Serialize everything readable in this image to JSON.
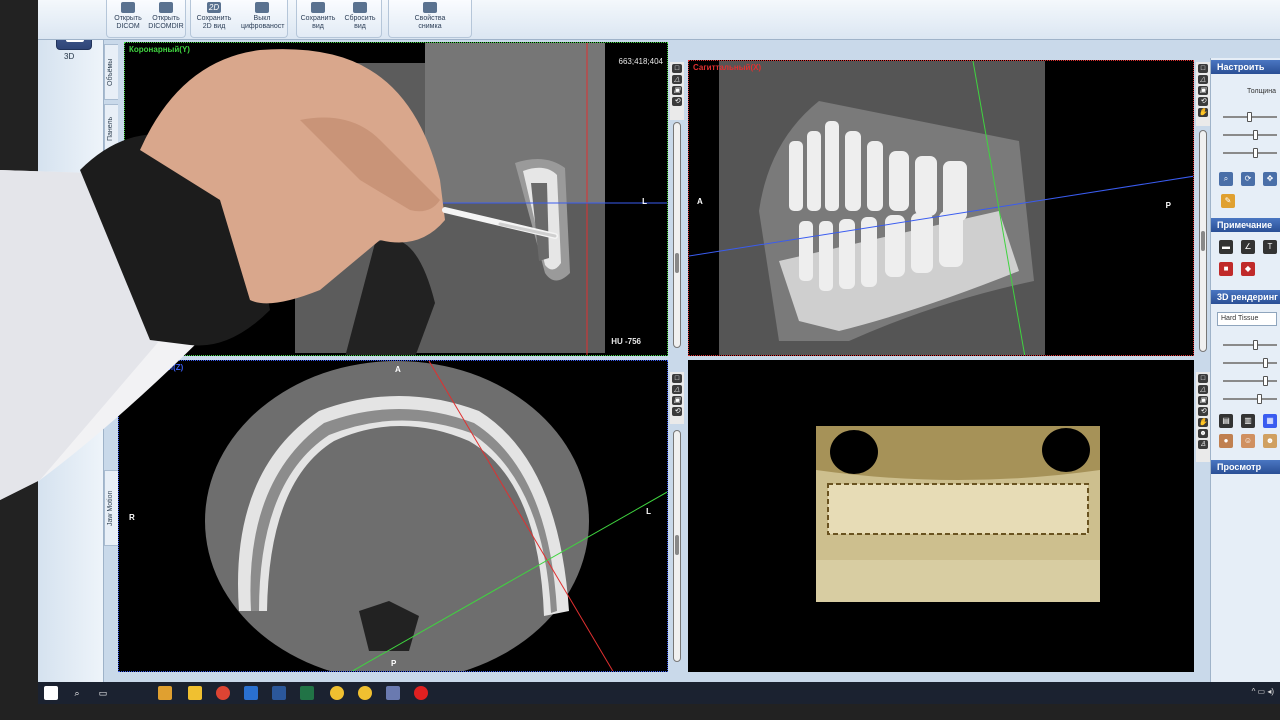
{
  "toolbar": {
    "open_dicom": "Открыть DICOM",
    "open_dicomdir": "Открыть DICOMDIR",
    "save_2d": "Сохранить 2D вид",
    "invert": "Выкл цифрованост",
    "save_view": "Сохранить вид",
    "reset_view": "Сбросить вид",
    "image_props": "Свойства снимка",
    "icon_2d": "2D"
  },
  "left_panel": {
    "mode_2d": "2D",
    "mode_3d": "3D",
    "tab_volume": "Объёмы",
    "tab_panel": "Панель",
    "tab_jaw": "Jaw Motion"
  },
  "viewports": {
    "coronal": {
      "title": "Коронарный(Y)",
      "coords": "663;418;404",
      "hu": "HU -756",
      "orient_right": "L",
      "color": "#3fd43f"
    },
    "sagittal": {
      "title": "Сагиттальный(X)",
      "orient_left": "A",
      "orient_right": "P",
      "color": "#e03030"
    },
    "axial": {
      "title": "Аксиальный(Z)",
      "orient_top": "A",
      "orient_left": "R",
      "orient_right": "L",
      "orient_bottom": "P",
      "color": "#3a5cf0"
    },
    "render3d": {
      "title": ""
    }
  },
  "right_panel": {
    "settings_header": "Настроить",
    "thickness_label": "Толщина",
    "notes_header": "Примечание",
    "render_header": "3D рендеринг",
    "render_mode": "Hard Tissue",
    "view_header": "Просмотр"
  },
  "colors": {
    "accent": "#2a4f95",
    "coronal_line": "#3fd43f",
    "sagittal_line": "#e03030",
    "axial_line": "#3a5cf0"
  }
}
